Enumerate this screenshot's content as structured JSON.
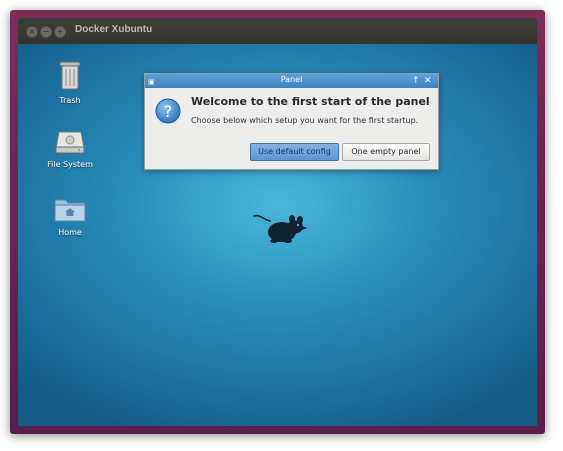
{
  "window": {
    "title": "Docker Xubuntu",
    "controls": [
      "close",
      "minimize",
      "maximize"
    ]
  },
  "desktop": {
    "icons": [
      {
        "label": "Trash",
        "icon": "trash-icon"
      },
      {
        "label": "File System",
        "icon": "drive-icon"
      },
      {
        "label": "Home",
        "icon": "home-folder-icon"
      }
    ],
    "wallpaper_logo": "xfce-mouse-icon"
  },
  "dialog": {
    "title": "Panel",
    "heading": "Welcome to the first start of the panel",
    "message": "Choose below which setup you want for the first startup.",
    "default_button": "Use default config",
    "empty_button": "One empty panel",
    "pin_symbol": "↑",
    "close_symbol": "✕",
    "icon": "question-icon"
  },
  "colors": {
    "accent": "#4a8fd0",
    "window_frame": "#6a2550",
    "desktop_blue": "#2b8fbd"
  }
}
